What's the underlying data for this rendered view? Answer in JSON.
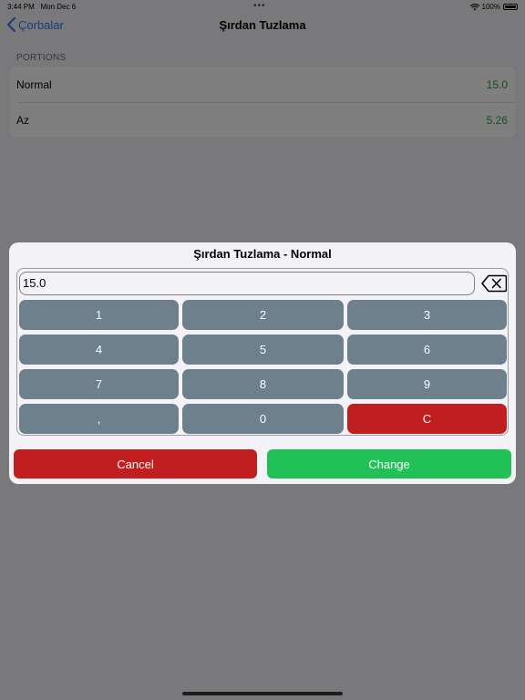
{
  "status_bar": {
    "time": "3:44 PM",
    "date": "Mon Dec 6",
    "battery": "100%",
    "icons": [
      "wifi-icon",
      "battery-icon"
    ]
  },
  "nav": {
    "back_label": "Çorbalar",
    "title": "Şırdan Tuzlama"
  },
  "portions": {
    "header": "PORTIONS",
    "rows": [
      {
        "label": "Normal",
        "value": "15.0"
      },
      {
        "label": "Az",
        "value": "5.26"
      }
    ]
  },
  "dialog": {
    "title": "Şırdan Tuzlama - Normal",
    "input_value": "15.0",
    "keys": [
      "1",
      "2",
      "3",
      "4",
      "5",
      "6",
      "7",
      "8",
      "9",
      ",",
      "0",
      "C"
    ],
    "cancel_label": "Cancel",
    "change_label": "Change"
  },
  "colors": {
    "accent_blue": "#2f7cf6",
    "value_green": "#2a9c3e",
    "key_gray": "#6e808c",
    "danger_red": "#c11f1f",
    "confirm_green": "#21c157"
  }
}
